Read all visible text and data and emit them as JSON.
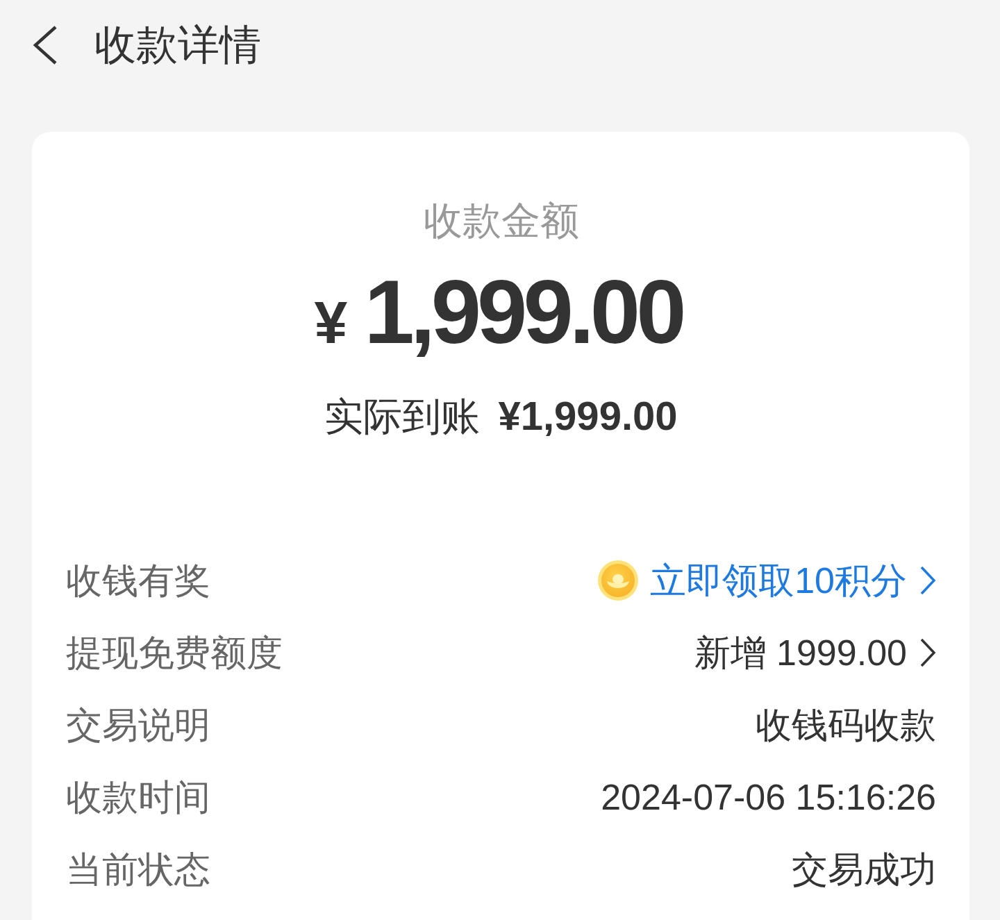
{
  "header": {
    "title": "收款详情"
  },
  "summary": {
    "label": "收款金额",
    "currency": "¥",
    "amount": "1,999.00",
    "received_label": "实际到账",
    "received_amount": "¥1,999.00"
  },
  "details": [
    {
      "label": "收钱有奖",
      "value": "立即领取10积分",
      "kind": "reward"
    },
    {
      "label": "提现免费额度",
      "value": "新增 1999.00",
      "kind": "link"
    },
    {
      "label": "交易说明",
      "value": "收钱码收款",
      "kind": "text"
    },
    {
      "label": "收款时间",
      "value": "2024-07-06 15:16:26",
      "kind": "text"
    },
    {
      "label": "当前状态",
      "value": "交易成功",
      "kind": "text"
    }
  ]
}
